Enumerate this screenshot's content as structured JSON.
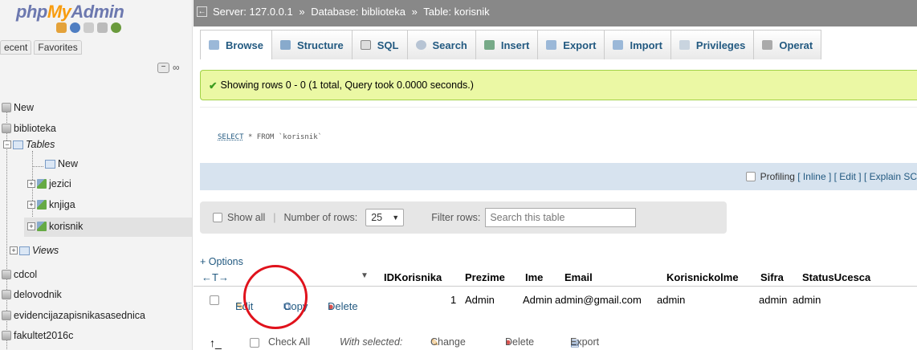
{
  "sidebar": {
    "logo": {
      "part1": "php",
      "part2": "My",
      "part3": "Admin"
    },
    "tabs": [
      "ecent",
      "Favorites"
    ],
    "tree": {
      "new_root": "New",
      "db_biblioteka": "biblioteka",
      "tables_label": "Tables",
      "tables_new": "New",
      "table1": "jezici",
      "table2": "knjiga",
      "table3": "korisnik",
      "views_label": "Views",
      "db2": "cdcol",
      "db3": "delovodnik",
      "db4": "evidencijazapisnikasasednica",
      "db5": "fakultet2016c"
    }
  },
  "topbar": {
    "back": "←",
    "server": "Server: 127.0.0.1",
    "sep1": "»",
    "database": "Database: biblioteka",
    "sep2": "»",
    "table": "Table: korisnik"
  },
  "tabs": [
    "Browse",
    "Structure",
    "SQL",
    "Search",
    "Insert",
    "Export",
    "Import",
    "Privileges",
    "Operat"
  ],
  "main": {
    "success": "Showing rows 0 - 0 (1 total, Query took 0.0000 seconds.)",
    "sql_kw": "SELECT",
    "sql_rest": "* FROM `korisnik`",
    "profiling": "Profiling",
    "prof_links": "[ Inline ] [ Edit ] [ Explain SC",
    "show_all": "Show all",
    "number_of_rows_label": "Number of rows:",
    "number_of_rows_value": "25",
    "filter_label": "Filter rows:",
    "filter_placeholder": "Search this table",
    "options": "+ Options",
    "columns": [
      "IDKorisnika",
      "Prezime",
      "Ime",
      "Email",
      "Korisnickolme",
      "Sifra",
      "StatusUcesca"
    ],
    "row": {
      "edit": "Edit",
      "copy": "Copy",
      "delete": "Delete",
      "values": [
        "1",
        "Admin",
        "Admin",
        "admin@gmail.com",
        "admin",
        "admin",
        "admin"
      ]
    },
    "bottom": {
      "check_all": "Check All",
      "with_selected": "With selected:",
      "change": "Change",
      "delete": "Delete",
      "export": "Export"
    }
  },
  "colors": {
    "accent": "#235a81",
    "success_bg": "#ebf8a4",
    "topbar": "#888888",
    "highlight": "#e0121c"
  }
}
